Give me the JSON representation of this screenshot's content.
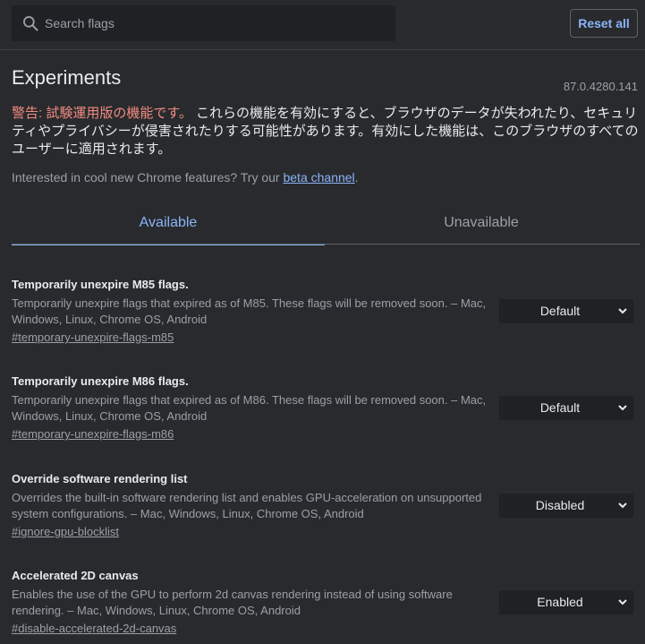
{
  "search": {
    "placeholder": "Search flags"
  },
  "header": {
    "reset_label": "Reset all"
  },
  "page": {
    "title": "Experiments",
    "version": "87.0.4280.141"
  },
  "warning": {
    "prefix": "警告: 試験運用版の機能です。",
    "text": " これらの機能を有効にすると、ブラウザのデータが失われたり、セキュリティやプライバシーが侵害されたりする可能性があります。有効にした機能は、このブラウザのすべてのユーザーに適用されます。"
  },
  "interest": {
    "text": "Interested in cool new Chrome features? Try our ",
    "link": "beta channel",
    "suffix": "."
  },
  "tabs": [
    {
      "label": "Available"
    },
    {
      "label": "Unavailable"
    }
  ],
  "flags": [
    {
      "name": "Temporarily unexpire M85 flags.",
      "description": "Temporarily unexpire flags that expired as of M85. These flags will be removed soon. – Mac, Windows, Linux, Chrome OS, Android",
      "link": "#temporary-unexpire-flags-m85",
      "value": "Default"
    },
    {
      "name": "Temporarily unexpire M86 flags.",
      "description": "Temporarily unexpire flags that expired as of M86. These flags will be removed soon. – Mac, Windows, Linux, Chrome OS, Android",
      "link": "#temporary-unexpire-flags-m86",
      "value": "Default"
    },
    {
      "name": "Override software rendering list",
      "description": "Overrides the built-in software rendering list and enables GPU-acceleration on unsupported system configurations. – Mac, Windows, Linux, Chrome OS, Android",
      "link": "#ignore-gpu-blocklist",
      "value": "Disabled"
    },
    {
      "name": "Accelerated 2D canvas",
      "description": "Enables the use of the GPU to perform 2d canvas rendering instead of using software rendering. – Mac, Windows, Linux, Chrome OS, Android",
      "link": "#disable-accelerated-2d-canvas",
      "value": "Enabled"
    }
  ],
  "colors": {
    "accent": "#8ab4f8",
    "warning": "#f28b82",
    "background": "#292a2d",
    "field": "#202124"
  }
}
